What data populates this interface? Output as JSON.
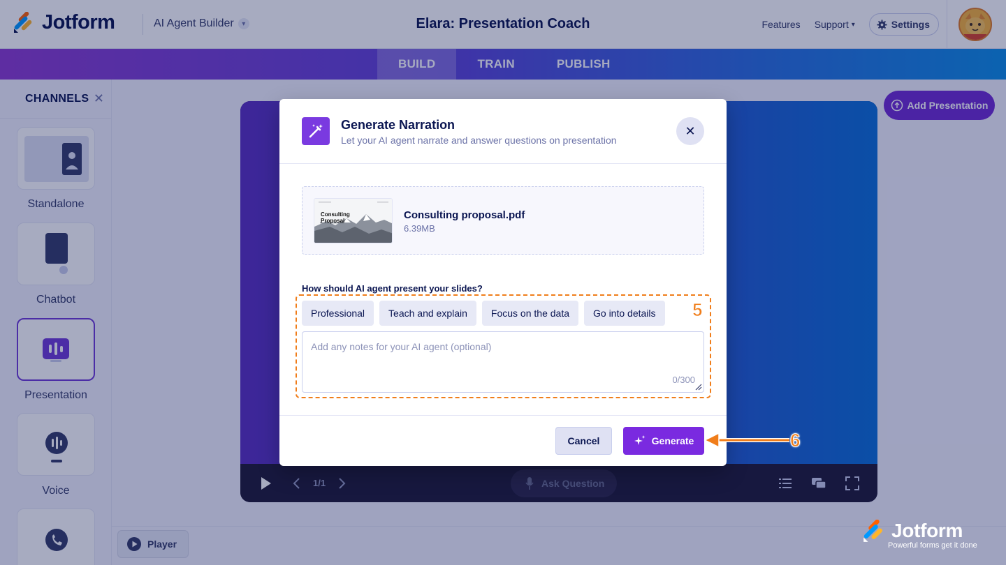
{
  "header": {
    "brand": "Jotform",
    "app_switch": "AI Agent Builder",
    "title": "Elara: Presentation Coach",
    "features": "Features",
    "support": "Support",
    "settings": "Settings"
  },
  "tabs": [
    {
      "label": "BUILD",
      "active": true
    },
    {
      "label": "TRAIN",
      "active": false
    },
    {
      "label": "PUBLISH",
      "active": false
    }
  ],
  "sidebar": {
    "title": "CHANNELS",
    "items": [
      {
        "label": "Standalone"
      },
      {
        "label": "Chatbot"
      },
      {
        "label": "Presentation"
      },
      {
        "label": "Voice"
      },
      {
        "label": ""
      }
    ]
  },
  "main": {
    "add_presentation": "Add Presentation",
    "player": "Player",
    "slide_counter": "1/1",
    "ask_question": "Ask Question"
  },
  "footer_brand": {
    "name": "Jotform",
    "tagline": "Powerful forms get it done"
  },
  "modal": {
    "title": "Generate Narration",
    "subtitle": "Let your AI agent narrate and answer questions on presentation",
    "file": {
      "name": "Consulting proposal.pdf",
      "size": "6.39MB",
      "thumb_title_1": "Consulting",
      "thumb_title_2": "Proposal"
    },
    "question": "How should AI agent present your slides?",
    "styles": [
      "Professional",
      "Teach and explain",
      "Focus on the data",
      "Go into details"
    ],
    "notes_placeholder": "Add any notes for your AI agent (optional)",
    "notes_counter": "0/300",
    "cancel": "Cancel",
    "generate": "Generate"
  },
  "annotations": {
    "step_5": "5",
    "step_6": "6"
  },
  "colors": {
    "accent": "#7a2ae0",
    "highlight": "#f07d1a",
    "navy": "#0a1551"
  }
}
